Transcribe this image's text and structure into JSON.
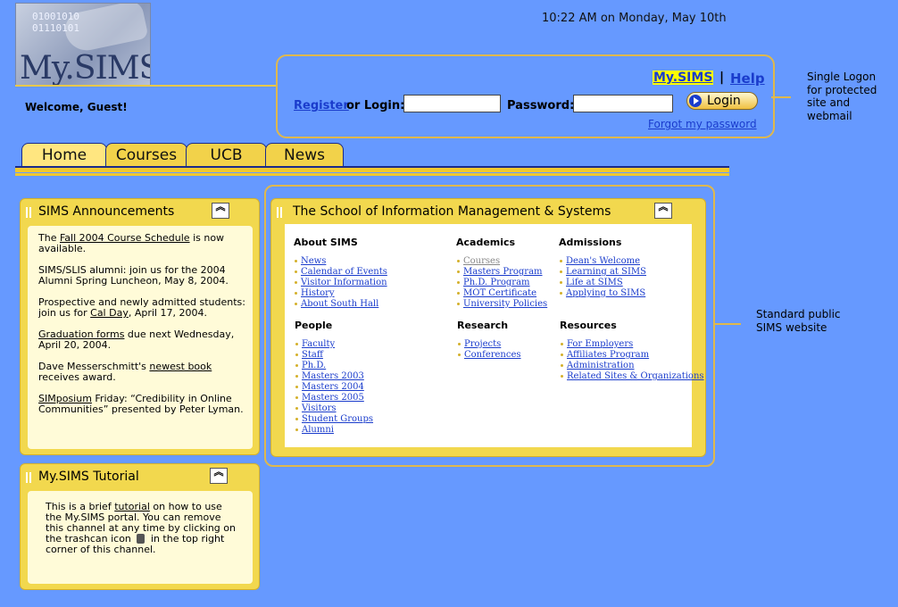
{
  "header": {
    "logo_text": "My.SIMS",
    "logo_bits": [
      "01001010",
      "01110101"
    ],
    "clock": "10:22 AM on Monday, May 10th",
    "welcome": "Welcome, Guest!"
  },
  "login": {
    "mysims_link": "My.SIMS",
    "separator": "|",
    "help_link": "Help",
    "register_link": "Register",
    "or_login": "or Login:",
    "username_value": "",
    "password_label": "Password:",
    "password_value": "",
    "login_button": "Login",
    "forgot_link": "Forgot my password"
  },
  "callouts": {
    "login_note": "Single Logon for protected site and webmail",
    "public_note": "Standard public SIMS website"
  },
  "tabs": [
    {
      "label": "Home"
    },
    {
      "label": "Courses"
    },
    {
      "label": "UCB"
    },
    {
      "label": "News"
    }
  ],
  "announcements": {
    "title": "SIMS Announcements",
    "items": [
      {
        "pre": "The ",
        "link": "Fall 2004 Course Schedule",
        "post": " is now available."
      },
      {
        "pre": "SIMS/SLIS alumni: join us for the 2004 Alumni Spring Luncheon, May 8, 2004.",
        "link": "",
        "post": ""
      },
      {
        "pre": "Prospective and newly admitted students: join us for ",
        "link": "Cal Day",
        "post": ", April 17, 2004."
      },
      {
        "pre": "",
        "link": "Graduation forms",
        "post": " due next Wednesday, April 20, 2004."
      },
      {
        "pre": "Dave Messerschmitt's ",
        "link": "newest book",
        "post": " receives award."
      },
      {
        "pre": "",
        "link": "SIMposium",
        "post": " Friday:  “Credibility in Online Communities” presented by Peter Lyman."
      }
    ]
  },
  "tutorial": {
    "title": "My.SIMS Tutorial",
    "pre": "This is a brief ",
    "link": "tutorial",
    "mid": " on how to use the My.SIMS portal.  You can remove this channel at any time by clicking on the trashcan icon ",
    "post": " in the top right corner of this channel."
  },
  "school": {
    "title": "The School of Information Management & Systems",
    "columns": [
      {
        "heading": "About SIMS",
        "items": [
          "News",
          "Calendar of Events",
          "Visitor Information",
          "History",
          "About South Hall"
        ]
      },
      {
        "heading": "Academics",
        "items": [
          "Courses",
          "Masters Program",
          "Ph.D. Program",
          "MOT Certificate",
          "University Policies"
        ]
      },
      {
        "heading": "Admissions",
        "items": [
          "Dean's Welcome",
          "Learning at SIMS",
          "Life at SIMS",
          "Applying to SIMS"
        ]
      },
      {
        "heading": "People",
        "items": [
          "Faculty",
          "Staff",
          "Ph.D.",
          "Masters 2003",
          "Masters 2004",
          "Masters 2005",
          "Visitors",
          "Student Groups",
          "Alumni"
        ]
      },
      {
        "heading": "Research",
        "items": [
          "Projects",
          "Conferences"
        ]
      },
      {
        "heading": "Resources",
        "items": [
          "For Employers",
          "Affiliates Program",
          "Administration",
          "Related Sites & Organizations"
        ]
      }
    ]
  },
  "colors": {
    "background": "#6699ff",
    "channel": "#f2d84e",
    "link": "#1a3ccc",
    "highlight": "#ffff00"
  }
}
